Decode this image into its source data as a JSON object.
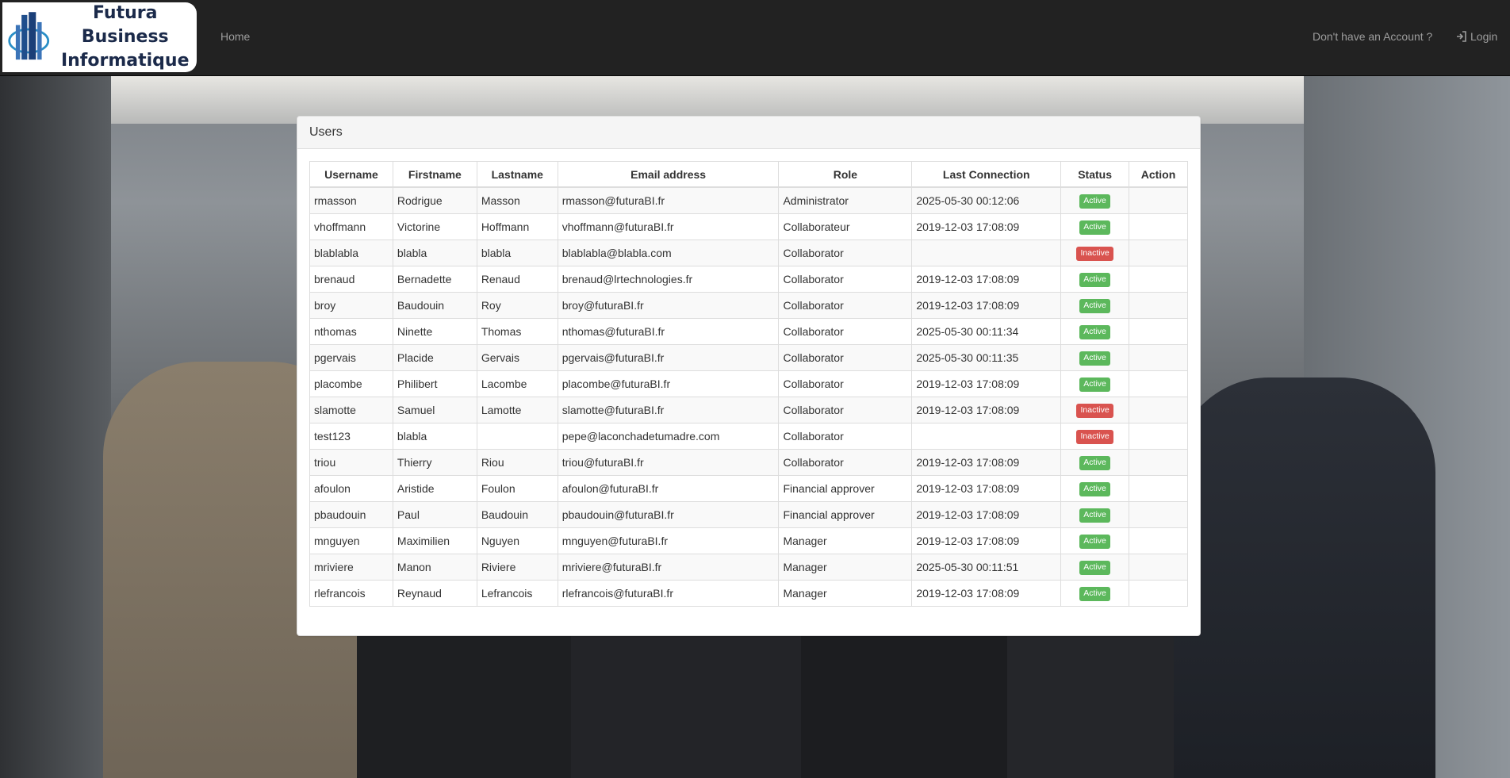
{
  "navbar": {
    "brand_line1": "Futura Business",
    "brand_line2": "Informatique",
    "home": "Home",
    "signup": "Don't have an Account ?",
    "login": "Login",
    "icons": {
      "brand": "building-logo-icon",
      "login": "sign-in-icon"
    }
  },
  "panel": {
    "title": "Users",
    "columns": [
      "Username",
      "Firstname",
      "Lastname",
      "Email address",
      "Role",
      "Last Connection",
      "Status",
      "Action"
    ],
    "rows": [
      {
        "username": "rmasson",
        "firstname": "Rodrigue",
        "lastname": "Masson",
        "email": "rmasson@futuraBI.fr",
        "role": "Administrator",
        "last_connection": "2025-05-30 00:12:06",
        "status": "Active",
        "action": ""
      },
      {
        "username": "vhoffmann",
        "firstname": "Victorine",
        "lastname": "Hoffmann",
        "email": "vhoffmann@futuraBI.fr",
        "role": "Collaborateur",
        "last_connection": "2019-12-03 17:08:09",
        "status": "Active",
        "action": ""
      },
      {
        "username": "blablabla",
        "firstname": "blabla",
        "lastname": "blabla",
        "email": "blablabla@blabla.com",
        "role": "Collaborator",
        "last_connection": "",
        "status": "Inactive",
        "action": ""
      },
      {
        "username": "brenaud",
        "firstname": "Bernadette",
        "lastname": "Renaud",
        "email": "brenaud@lrtechnologies.fr",
        "role": "Collaborator",
        "last_connection": "2019-12-03 17:08:09",
        "status": "Active",
        "action": ""
      },
      {
        "username": "broy",
        "firstname": "Baudouin",
        "lastname": "Roy",
        "email": "broy@futuraBI.fr",
        "role": "Collaborator",
        "last_connection": "2019-12-03 17:08:09",
        "status": "Active",
        "action": ""
      },
      {
        "username": "nthomas",
        "firstname": "Ninette",
        "lastname": "Thomas",
        "email": "nthomas@futuraBI.fr",
        "role": "Collaborator",
        "last_connection": "2025-05-30 00:11:34",
        "status": "Active",
        "action": ""
      },
      {
        "username": "pgervais",
        "firstname": "Placide",
        "lastname": "Gervais",
        "email": "pgervais@futuraBI.fr",
        "role": "Collaborator",
        "last_connection": "2025-05-30 00:11:35",
        "status": "Active",
        "action": ""
      },
      {
        "username": "placombe",
        "firstname": "Philibert",
        "lastname": "Lacombe",
        "email": "placombe@futuraBI.fr",
        "role": "Collaborator",
        "last_connection": "2019-12-03 17:08:09",
        "status": "Active",
        "action": ""
      },
      {
        "username": "slamotte",
        "firstname": "Samuel",
        "lastname": "Lamotte",
        "email": "slamotte@futuraBI.fr",
        "role": "Collaborator",
        "last_connection": "2019-12-03 17:08:09",
        "status": "Inactive",
        "action": ""
      },
      {
        "username": "test123",
        "firstname": "blabla",
        "lastname": "",
        "email": "pepe@laconchadetumadre.com",
        "role": "Collaborator",
        "last_connection": "",
        "status": "Inactive",
        "action": ""
      },
      {
        "username": "triou",
        "firstname": "Thierry",
        "lastname": "Riou",
        "email": "triou@futuraBI.fr",
        "role": "Collaborator",
        "last_connection": "2019-12-03 17:08:09",
        "status": "Active",
        "action": ""
      },
      {
        "username": "afoulon",
        "firstname": "Aristide",
        "lastname": "Foulon",
        "email": "afoulon@futuraBI.fr",
        "role": "Financial approver",
        "last_connection": "2019-12-03 17:08:09",
        "status": "Active",
        "action": ""
      },
      {
        "username": "pbaudouin",
        "firstname": "Paul",
        "lastname": "Baudouin",
        "email": "pbaudouin@futuraBI.fr",
        "role": "Financial approver",
        "last_connection": "2019-12-03 17:08:09",
        "status": "Active",
        "action": ""
      },
      {
        "username": "mnguyen",
        "firstname": "Maximilien",
        "lastname": "Nguyen",
        "email": "mnguyen@futuraBI.fr",
        "role": "Manager",
        "last_connection": "2019-12-03 17:08:09",
        "status": "Active",
        "action": ""
      },
      {
        "username": "mriviere",
        "firstname": "Manon",
        "lastname": "Riviere",
        "email": "mriviere@futuraBI.fr",
        "role": "Manager",
        "last_connection": "2025-05-30 00:11:51",
        "status": "Active",
        "action": ""
      },
      {
        "username": "rlefrancois",
        "firstname": "Reynaud",
        "lastname": "Lefrancois",
        "email": "rlefrancois@futuraBI.fr",
        "role": "Manager",
        "last_connection": "2019-12-03 17:08:09",
        "status": "Active",
        "action": ""
      }
    ]
  },
  "colors": {
    "navbar_bg": "#222222",
    "nav_link": "#9d9d9d",
    "status_active": "#5cb85c",
    "status_inactive": "#d9534f"
  }
}
